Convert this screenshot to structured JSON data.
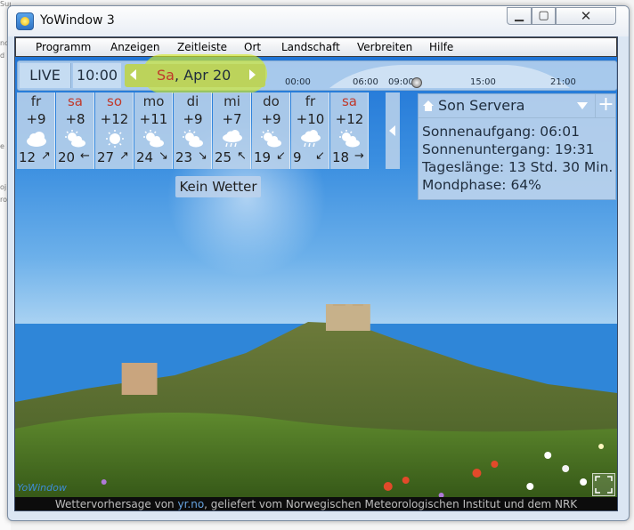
{
  "window": {
    "title": "YoWindow 3",
    "controls": {
      "minimize": "▁",
      "maximize": "▢",
      "close": "✕"
    }
  },
  "menu": [
    "Programm",
    "Anzeigen",
    "Zeitleiste",
    "Ort",
    "Landschaft",
    "Verbreiten",
    "Hilfe"
  ],
  "timeline": {
    "live_label": "LIVE",
    "time": "10:00",
    "date_day": "Sa",
    "date_rest": ", Apr 20",
    "ticks": [
      "00:00",
      "06:00",
      "09:00",
      "15:00",
      "21:00"
    ],
    "highlight_color": "#d2eb28"
  },
  "forecast": [
    {
      "day": "fr",
      "temp": "+9",
      "icon": "cloud-icon",
      "wind": "12",
      "dir": "↗",
      "weekend": false
    },
    {
      "day": "sa",
      "temp": "+8",
      "icon": "sun-cloud-icon",
      "wind": "20",
      "dir": "←",
      "weekend": true
    },
    {
      "day": "so",
      "temp": "+12",
      "icon": "sun-icon",
      "wind": "27",
      "dir": "↗",
      "weekend": true
    },
    {
      "day": "mo",
      "temp": "+11",
      "icon": "sun-cloud-icon",
      "wind": "24",
      "dir": "↘",
      "weekend": false
    },
    {
      "day": "di",
      "temp": "+9",
      "icon": "sun-cloud-icon",
      "wind": "23",
      "dir": "↘",
      "weekend": false
    },
    {
      "day": "mi",
      "temp": "+7",
      "icon": "rain-icon",
      "wind": "25",
      "dir": "↖",
      "weekend": false
    },
    {
      "day": "do",
      "temp": "+9",
      "icon": "sun-cloud-icon",
      "wind": "19",
      "dir": "↙",
      "weekend": false
    },
    {
      "day": "fr",
      "temp": "+10",
      "icon": "rain-icon",
      "wind": "9",
      "dir": "↙",
      "weekend": false
    },
    {
      "day": "sa",
      "temp": "+12",
      "icon": "sun-cloud-icon",
      "wind": "18",
      "dir": "→",
      "weekend": true
    }
  ],
  "no_weather": "Kein Wetter",
  "location": {
    "name": "Son Servera",
    "add": "+",
    "lines": [
      "Sonnenaufgang:  06:01",
      "Sonnenuntergang:  19:31",
      "Tageslänge:  13 Std. 30 Min.",
      "Mondphase:  64%"
    ]
  },
  "brand": "YoWindow",
  "footer": {
    "prefix": "Wettervorhersage von ",
    "link": "yr.no",
    "suffix": ", geliefert vom Norwegischen Meteorologischen Institut und dem NRK"
  },
  "background_left": [
    "Support",
    "nc",
    "d",
    "e",
    "oj",
    "ro"
  ],
  "colors": {
    "sky_top": "#1f74d6",
    "weekend_red": "#c0392b",
    "link_blue": "#66a3e0"
  }
}
